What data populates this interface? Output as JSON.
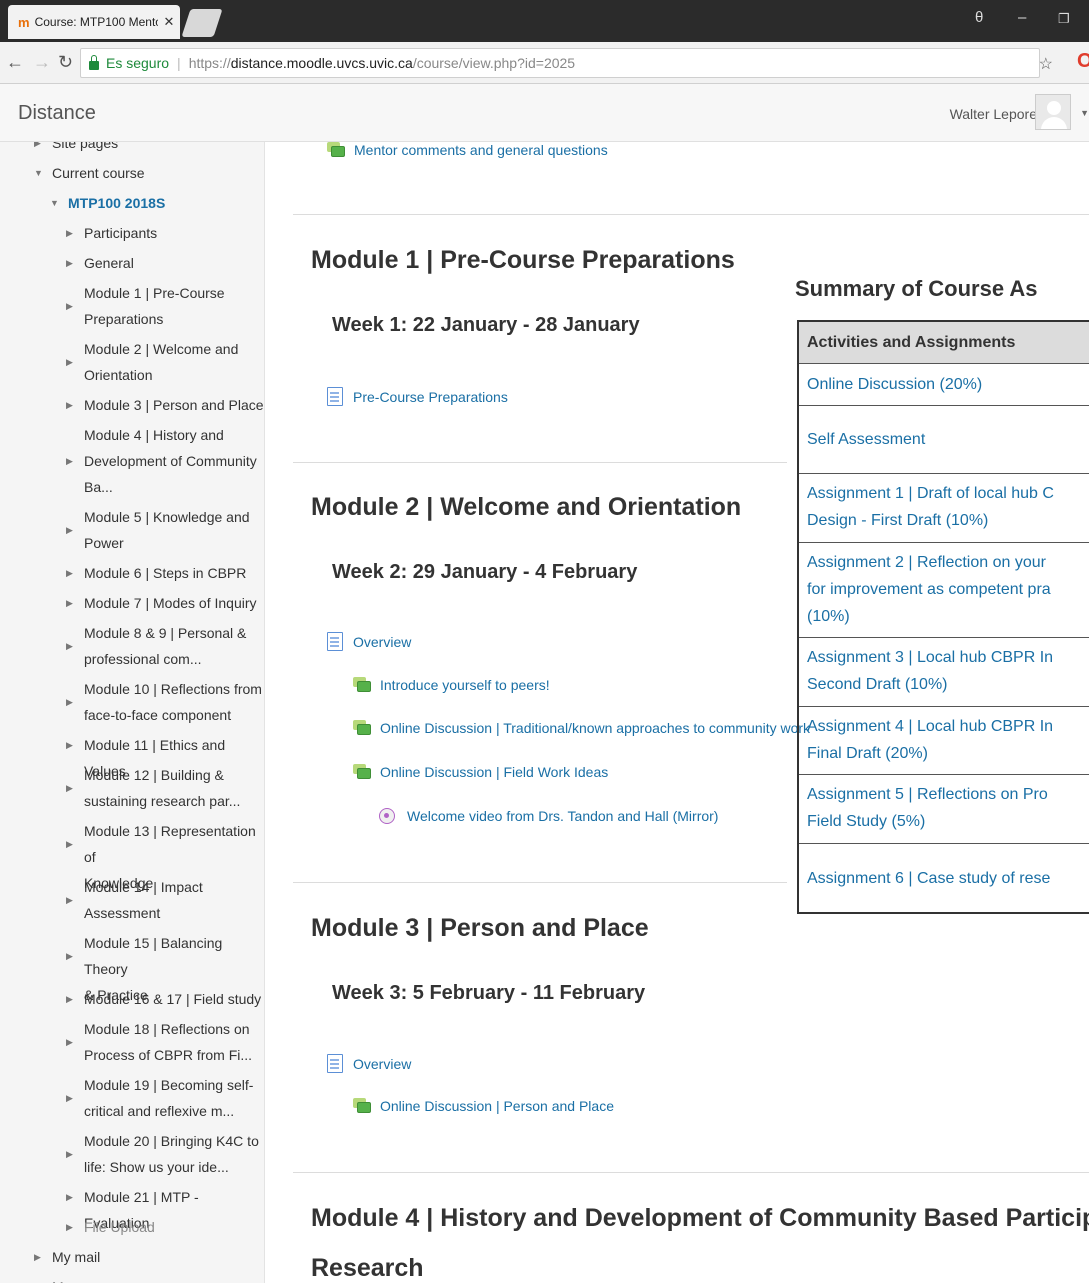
{
  "browser": {
    "tab_title": "Course: MTP100 Mentor",
    "tab_close": "✕",
    "favicon": "m",
    "url_secure_label": "Es seguro",
    "url_scheme": "https://",
    "url_host": "distance.moodle.uvcs.uvic.ca",
    "url_path": "/course/view.php?id=2025",
    "badge": "O",
    "icons": [
      "favicon-icon",
      "close-tab-icon",
      "back-icon",
      "forward-icon",
      "reload-icon",
      "lock-icon",
      "star-icon",
      "profile-icon",
      "minimize-icon",
      "maximize-icon"
    ]
  },
  "header": {
    "brand": "Distance",
    "user_name": "Walter Lepore"
  },
  "nav": {
    "items": [
      {
        "label": "Site pages",
        "indent": 0,
        "expanded": false
      },
      {
        "label": "Current course",
        "indent": 0,
        "expanded": true
      },
      {
        "label": "MTP100 2018S",
        "indent": 1,
        "expanded": true,
        "active": true
      },
      {
        "label": "Participants",
        "indent": 2,
        "link": true
      },
      {
        "label": "General",
        "indent": 2
      },
      {
        "label": "Module 1 | Pre-Course",
        "label2": "Preparations",
        "indent": 2
      },
      {
        "label": "Module 2 | Welcome and",
        "label2": "Orientation",
        "indent": 2
      },
      {
        "label": "Module 3 | Person and Place",
        "indent": 2
      },
      {
        "label": "Module 4 | History and",
        "label2": "Development of Community",
        "label3": "Ba...",
        "indent": 2
      },
      {
        "label": "Module 5 | Knowledge and",
        "label2": "Power",
        "indent": 2
      },
      {
        "label": "Module 6 | Steps in CBPR",
        "indent": 2
      },
      {
        "label": "Module 7 | Modes of Inquiry",
        "indent": 2
      },
      {
        "label": "Module 8 & 9 | Personal &",
        "label2": "professional com...",
        "indent": 2
      },
      {
        "label": "Module 10 | Reflections from",
        "label2": "face-to-face component",
        "indent": 2
      },
      {
        "label": "Module 11 | Ethics and Values",
        "indent": 2
      },
      {
        "label": "Module 12 | Building &",
        "label2": "sustaining research par...",
        "indent": 2
      },
      {
        "label": "Module 13 | Representation of",
        "label2": "Knowledge",
        "indent": 2
      },
      {
        "label": "Module 14 | Impact",
        "label2": "Assessment",
        "indent": 2
      },
      {
        "label": "Module 15 | Balancing Theory",
        "label2": "& Practice",
        "indent": 2
      },
      {
        "label": "Module 16 & 17 | Field study",
        "indent": 2
      },
      {
        "label": "Module 18 | Reflections on",
        "label2": "Process of CBPR from Fi...",
        "indent": 2
      },
      {
        "label": "Module 19 | Becoming self-",
        "label2": "critical and reflexive m...",
        "indent": 2
      },
      {
        "label": "Module 20 | Bringing K4C to",
        "label2": "life: Show us your ide...",
        "indent": 2
      },
      {
        "label": "Module 21 | MTP - Evaluation",
        "indent": 2
      },
      {
        "label": "File Upload",
        "indent": 2,
        "muted": true
      },
      {
        "label": "My mail",
        "indent": 0
      },
      {
        "label": "My courses",
        "indent": 0
      }
    ]
  },
  "main": {
    "top_activity": "Mentor comments and general questions",
    "modules": [
      {
        "title": "Module 1 | Pre-Course Preparations",
        "week": "Week 1: 22 January - 28 January",
        "activities": [
          {
            "type": "page",
            "label": "Pre-Course Preparations",
            "level": 0
          }
        ]
      },
      {
        "title": "Module 2 | Welcome and Orientation",
        "week": "Week 2: 29 January - 4 February",
        "activities": [
          {
            "type": "page",
            "label": "Overview",
            "level": 0
          },
          {
            "type": "forum",
            "label": "Introduce yourself to peers!",
            "level": 1
          },
          {
            "type": "forum",
            "label": "Online Discussion | Traditional/known approaches to community work",
            "level": 1
          },
          {
            "type": "forum",
            "label": "Online Discussion | Field Work Ideas",
            "level": 1
          },
          {
            "type": "video",
            "label": "Welcome video from Drs. Tandon and Hall (Mirror)",
            "level": 2
          }
        ]
      },
      {
        "title": "Module 3 | Person and Place",
        "week": "Week 3: 5 February - 11 February",
        "activities": [
          {
            "type": "page",
            "label": "Overview",
            "level": 0
          },
          {
            "type": "forum",
            "label": "Online Discussion | Person and Place",
            "level": 1
          }
        ]
      },
      {
        "title": "Module 4 | History and Development of Community Based Participatory",
        "title2": "Research"
      }
    ],
    "summary": {
      "heading": "Summary of Course As",
      "header": "Activities and Assignments",
      "rows": [
        {
          "line1": "Online Discussion (20%)"
        },
        {
          "line1": "Self Assessment"
        },
        {
          "line1": "Assignment 1 | Draft of local hub C",
          "line2": "Design - First Draft (10%)"
        },
        {
          "line1": "Assignment 2 | Reflection on your",
          "line2": "for improvement as competent pra",
          "line3": "(10%)"
        },
        {
          "line1": "Assignment 3 | Local hub CBPR In",
          "line2": "Second Draft (10%)"
        },
        {
          "line1": "Assignment 4 | Local hub CBPR In",
          "line2": "Final Draft (20%)"
        },
        {
          "line1": "Assignment 5 | Reflections on Pro",
          "line2": "Field Study (5%)"
        },
        {
          "line1": "Assignment 6 | Case study of rese"
        }
      ]
    }
  },
  "colors": {
    "link": "#1a6fa5",
    "secure": "#1e8a3b",
    "tabstrip": "#2b2b2b",
    "table_header_bg": "#dcdcdc"
  }
}
